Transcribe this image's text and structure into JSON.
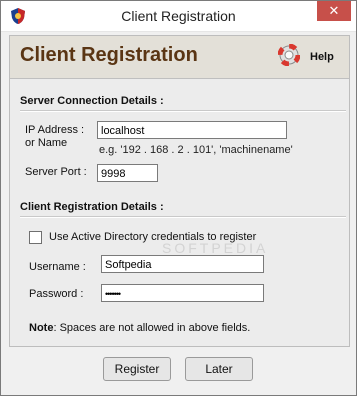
{
  "window": {
    "title": "Client Registration",
    "close_glyph": "✕"
  },
  "header": {
    "title": "Client Registration",
    "help_label": "Help"
  },
  "server_section": {
    "title": "Server Connection Details :",
    "ip_label_line1": "IP Address :",
    "ip_label_line2": "or Name",
    "ip_value": "localhost",
    "ip_hint": "e.g. '192 . 168 . 2 . 101', 'machinename'",
    "port_label": "Server Port :",
    "port_value": "9998"
  },
  "credentials_section": {
    "title": "Client Registration Details :",
    "ad_checkbox_label": "Use Active Directory credentials to register",
    "ad_checked": false,
    "username_label": "Username :",
    "username_value": "Softpedia",
    "password_label": "Password :",
    "password_value": "•••••••"
  },
  "note": {
    "bold": "Note",
    "text": ": Spaces are not allowed in above fields."
  },
  "buttons": {
    "register": "Register",
    "later": "Later"
  },
  "watermark": "SOFTPEDIA",
  "colors": {
    "header_bg": "#e3e0d8",
    "title_brown": "#5a3514",
    "close_red": "#c7504a"
  },
  "icons": {
    "app": "shield-icon",
    "help": "lifebuoy-icon"
  }
}
